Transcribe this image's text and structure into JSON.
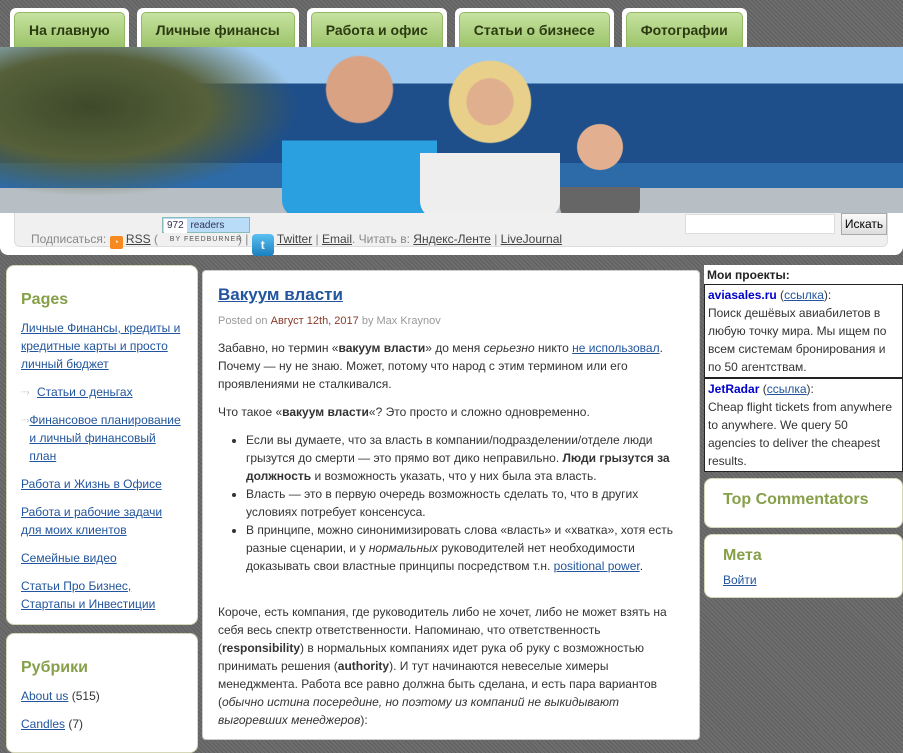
{
  "nav": [
    "На главную",
    "Личные финансы",
    "Работа и офис",
    "Статьи о бизнесе",
    "Фотографии"
  ],
  "subscribe": {
    "label": "Подписаться:",
    "rss": "RSS",
    "readers_count": "972",
    "readers_label": "readers",
    "feedburner": "BY FEEDBURNER",
    "twitter": "Twitter",
    "email": "Email",
    "read_in": ". Читать в:",
    "yandex": "Яндекс-Ленте",
    "livejournal": "LiveJournal",
    "search_placeholder": "",
    "search_button": "Искать"
  },
  "left": {
    "pages_title": "Pages",
    "pages": [
      {
        "label": "Личные Финансы, кредиты и кредитные карты и просто личный бюджет",
        "sub": false
      },
      {
        "label": "Статьи о деньгах",
        "sub": true
      },
      {
        "label": "Финансовое планирование и личный финансовый план",
        "sub": true
      },
      {
        "label": "Работа и Жизнь в Офисе",
        "sub": false
      },
      {
        "label": "Работа и рабочие задачи для моих клиентов",
        "sub": false
      },
      {
        "label": "Семейные видео",
        "sub": false
      },
      {
        "label": "Статьи Про Бизнес, Стартапы и Инвестиции",
        "sub": false
      }
    ],
    "rubrics_title": "Рубрики",
    "rubrics": [
      {
        "label": "About us",
        "count": "(515)"
      },
      {
        "label": "Candles",
        "count": "(7)"
      }
    ]
  },
  "post": {
    "title": "Вакуум власти",
    "posted_on": "Posted on",
    "date": "Август 12th, 2017",
    "by": "by Max Kraynov",
    "paragraphs": [
      [
        [
          "t",
          "Забавно, но термин «"
        ],
        [
          "b",
          "вакуум власти"
        ],
        [
          "t",
          "» до меня "
        ],
        [
          "i",
          "серьезно"
        ],
        [
          "t",
          " никто "
        ],
        [
          "a",
          "не использовал"
        ],
        [
          "t",
          ". Почему — ну не знаю. Может, потому что народ с этим термином или его проявлениями не сталкивался."
        ]
      ],
      [
        [
          "t",
          "Что такое «"
        ],
        [
          "b",
          "вакуум власти"
        ],
        [
          "t",
          "«? Это просто и сложно одновременно."
        ]
      ]
    ],
    "bullets": [
      [
        [
          "t",
          "Если вы думаете, что за власть в компании/подразделении/отделе люди грызутся до смерти — это прямо вот дико неправильно. "
        ],
        [
          "b",
          "Люди грызутся за должность"
        ],
        [
          "t",
          " и возможность указать, что у них была эта власть."
        ]
      ],
      [
        [
          "t",
          "Власть — это в первую очередь возможность сделать то, что в других условиях потребует консенсуса."
        ]
      ],
      [
        [
          "t",
          "В принципе, можно синонимизировать слова «власть» и «хватка», хотя есть разные сценарии, и у "
        ],
        [
          "i",
          "нормальных"
        ],
        [
          "t",
          " руководителей нет необходимости доказывать свои властные принципы посредством т.н. "
        ],
        [
          "a",
          "positional power"
        ],
        [
          "t",
          "."
        ]
      ]
    ],
    "paragraphs2": [
      [
        [
          "t",
          "Короче, есть компания, где руководитель либо не хочет, либо не может взять на себя весь спектр ответственности. Напоминаю, что ответственность ("
        ],
        [
          "b",
          "responsibility"
        ],
        [
          "t",
          ") в нормальных компаниях идет рука об руку с возможностью принимать решения ("
        ],
        [
          "b",
          "authority"
        ],
        [
          "t",
          "). И тут начинаются невеселые химеры менеджмента. Работа все равно должна быть сделана, и есть пара вариантов ("
        ],
        [
          "i",
          "обычно истина посередине, но поэтому из компаний не выкидывают выгоревших менеджеров"
        ],
        [
          "t",
          "):"
        ]
      ]
    ]
  },
  "right": {
    "projects_title": "Мои проекты:",
    "projects": [
      {
        "name": "aviasales.ru",
        "link": "ссылка",
        "desc": "Поиск дешёвых авиабилетов в любую точку мира. Мы ищем по всем системам бронирования и по 50 агентствам."
      },
      {
        "name": "JetRadar",
        "link": "ссылка",
        "desc": "Cheap flight tickets from anywhere to anywhere. We query 50 agencies to deliver the cheapest results."
      }
    ],
    "top_commentators": "Top Commentators",
    "meta_title": "Мета",
    "login": "Войти"
  },
  "colors": {
    "accent_green": "#86a04a",
    "link": "#22559d",
    "tab_green": "#9cc46a"
  }
}
